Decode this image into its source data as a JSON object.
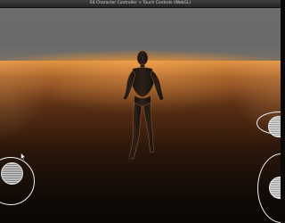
{
  "window": {
    "title": "64 Character Controller + Touch Controls (WebGL)"
  },
  "scene": {
    "sky_color": "#6b6b6b",
    "glow_color": "#f0a050",
    "floor_color": "#5a2f14"
  },
  "controls": {
    "left_joystick": "move-joystick",
    "right_joystick": "look-joystick",
    "jump_button": "jump-button"
  }
}
